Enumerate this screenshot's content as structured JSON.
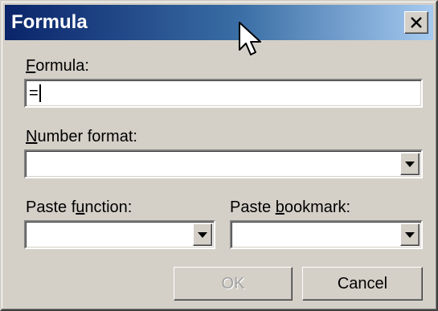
{
  "dialog": {
    "title": "Formula",
    "close_icon": "close-icon",
    "formula": {
      "label_prefix": "",
      "label_mnemonic": "F",
      "label_rest": "ormula:",
      "value": "="
    },
    "number_format": {
      "label_prefix": "",
      "label_mnemonic": "N",
      "label_rest": "umber format:",
      "selected": ""
    },
    "paste_function": {
      "label_prefix": "Paste f",
      "label_mnemonic": "u",
      "label_rest": "nction:",
      "selected": ""
    },
    "paste_bookmark": {
      "label_prefix": "Paste ",
      "label_mnemonic": "b",
      "label_rest": "ookmark:",
      "selected": ""
    },
    "buttons": {
      "ok": "OK",
      "cancel": "Cancel"
    },
    "colors": {
      "title_start": "#0a246a",
      "title_end": "#a6caf0",
      "face": "#d4d0c8"
    },
    "pointer_icon": "mouse-pointer-icon"
  }
}
